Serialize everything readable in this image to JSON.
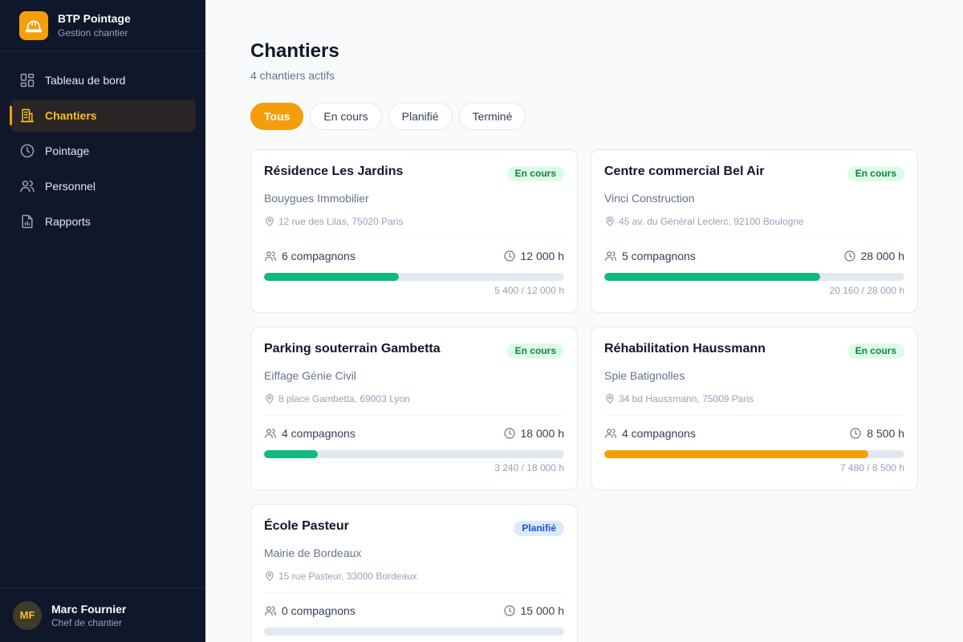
{
  "brand": {
    "title": "BTP Pointage",
    "subtitle": "Gestion chantier",
    "icon": "hardhat-icon"
  },
  "nav": [
    {
      "label": "Tableau de bord",
      "icon": "dashboard-icon",
      "active": false
    },
    {
      "label": "Chantiers",
      "icon": "building-icon",
      "active": true
    },
    {
      "label": "Pointage",
      "icon": "clock-icon",
      "active": false
    },
    {
      "label": "Personnel",
      "icon": "users-icon",
      "active": false
    },
    {
      "label": "Rapports",
      "icon": "report-icon",
      "active": false
    }
  ],
  "user": {
    "initials": "MF",
    "name": "Marc Fournier",
    "role": "Chef de chantier"
  },
  "page": {
    "title": "Chantiers",
    "subtitle": "4 chantiers actifs"
  },
  "filters": [
    {
      "label": "Tous",
      "active": true
    },
    {
      "label": "En cours",
      "active": false
    },
    {
      "label": "Planifié",
      "active": false
    },
    {
      "label": "Terminé",
      "active": false
    }
  ],
  "colors": {
    "accent": "#f59e0b",
    "progress_green": "#10b981",
    "progress_orange": "#f59e0b",
    "sidebar_bg": "#0f172a"
  },
  "sites": [
    {
      "name": "Résidence Les Jardins",
      "status": "En cours",
      "status_kind": "en-cours",
      "client": "Bouygues Immobilier",
      "address": "12 rue des Lilas, 75020 Paris",
      "workers": "6 compagnons",
      "hours": "12 000 h",
      "progress": 0.45,
      "progress_color": "#10b981",
      "progress_text": "5 400 / 12 000 h"
    },
    {
      "name": "Centre commercial Bel Air",
      "status": "En cours",
      "status_kind": "en-cours",
      "client": "Vinci Construction",
      "address": "45 av. du Général Leclerc, 92100 Boulogne",
      "workers": "5 compagnons",
      "hours": "28 000 h",
      "progress": 0.72,
      "progress_color": "#10b981",
      "progress_text": "20 160 / 28 000 h"
    },
    {
      "name": "Parking souterrain Gambetta",
      "status": "En cours",
      "status_kind": "en-cours",
      "client": "Eiffage Génie Civil",
      "address": "8 place Gambetta, 69003 Lyon",
      "workers": "4 compagnons",
      "hours": "18 000 h",
      "progress": 0.18,
      "progress_color": "#10b981",
      "progress_text": "3 240 / 18 000 h"
    },
    {
      "name": "Réhabilitation Haussmann",
      "status": "En cours",
      "status_kind": "en-cours",
      "client": "Spie Batignolles",
      "address": "34 bd Haussmann, 75009 Paris",
      "workers": "4 compagnons",
      "hours": "8 500 h",
      "progress": 0.88,
      "progress_color": "#f59e0b",
      "progress_text": "7 480 / 8 500 h"
    },
    {
      "name": "École Pasteur",
      "status": "Planifié",
      "status_kind": "planifie",
      "client": "Mairie de Bordeaux",
      "address": "15 rue Pasteur, 33000 Bordeaux",
      "workers": "0 compagnons",
      "hours": "15 000 h",
      "progress": 0,
      "progress_color": "#10b981",
      "progress_text": ""
    }
  ]
}
